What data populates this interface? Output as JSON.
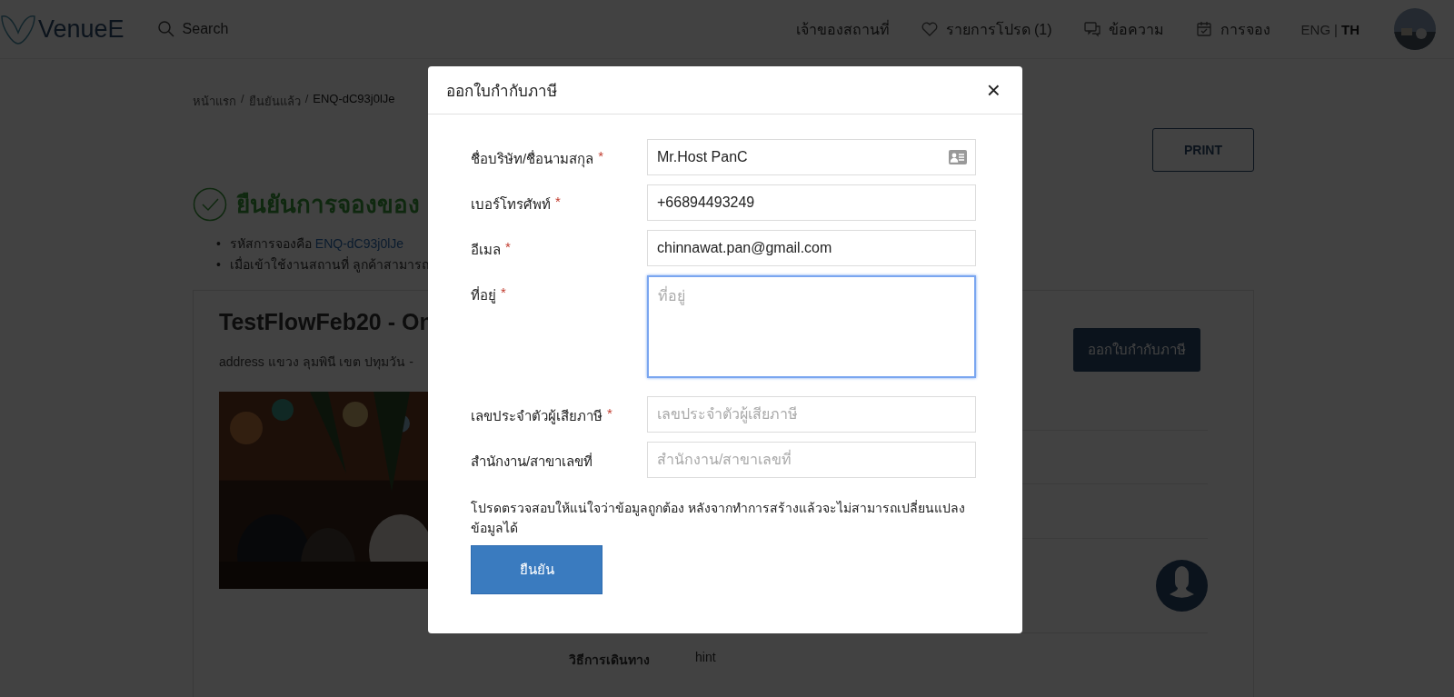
{
  "header": {
    "logo": "VenueE",
    "search": "Search",
    "nav": [
      {
        "kind": "plain",
        "label": "เจ้าของสถานที่"
      },
      {
        "kind": "heart",
        "label": "รายการโปรด (1)"
      },
      {
        "kind": "chat",
        "label": "ข้อความ"
      },
      {
        "kind": "calendar",
        "label": "การจอง"
      }
    ],
    "languages": [
      {
        "label": "ENG",
        "selected": false
      },
      {
        "label": "TH",
        "selected": true
      }
    ],
    "lang_separator": "|"
  },
  "breadcrumb": [
    {
      "label": "หน้าแรก",
      "current": false
    },
    {
      "label": "ยืนยันแล้ว",
      "current": false
    },
    {
      "label": "ENQ-dC93j0lJe",
      "current": true
    }
  ],
  "breadcrumb_separator": "/",
  "print_button": "PRINT",
  "confirmation": {
    "heading": "ยืนยันการจองของ",
    "bullet_mark": "•",
    "bullets": [
      {
        "text": "รหัสการจองคือ",
        "link": "ENQ-dC93j0lJe"
      },
      {
        "text": "เมื่อเข้าใช้งานสถานที่ ลูกค้าสามารถ"
      }
    ]
  },
  "card": {
    "title": "TestFlowFeb20 - On",
    "address": "address แขวง ลุมพินี เขต ปทุมวัน -",
    "tax_button": "ออกใบกำกับภาษี",
    "travel_label": "วิธีการเดินทาง",
    "travel_value": "hint"
  },
  "modal": {
    "title": "ออกใบกำกับภาษี",
    "close": "×",
    "fields": [
      {
        "kind": "autofill",
        "label": "ชื่อบริษัท/ชื่อนามสกุล",
        "required_mark": "*",
        "value": "Mr.Host PanC",
        "focused": false
      },
      {
        "kind": "text",
        "label": "เบอร์โทรศัพท์",
        "required_mark": "*",
        "value": "+66894493249",
        "focused": false
      },
      {
        "kind": "text",
        "label": "อีเมล",
        "required_mark": "*",
        "value": "chinnawat.pan@gmail.com",
        "focused": false
      },
      {
        "kind": "textarea",
        "label": "ที่อยู่",
        "required_mark": "*",
        "placeholder": "ที่อยู่",
        "focused": true
      },
      {
        "kind": "text",
        "label": "เลขประจำตัวผู้เสียภาษี",
        "required_mark": "*",
        "placeholder": "เลขประจำตัวผู้เสียภาษี",
        "focused": false
      },
      {
        "kind": "text",
        "label": "สำนักงาน/สาขาเลขที่",
        "placeholder": "สำนักงาน/สาขาเลขที่",
        "focused": false
      }
    ],
    "note": "โปรดตรวจสอบให้แน่ใจว่าข้อมูลถูกต้อง หลังจากทำการสร้างแล้วจะไม่สามารถเปลี่ยนแปลงข้อมูลได้",
    "confirm": "ยืนยัน"
  }
}
